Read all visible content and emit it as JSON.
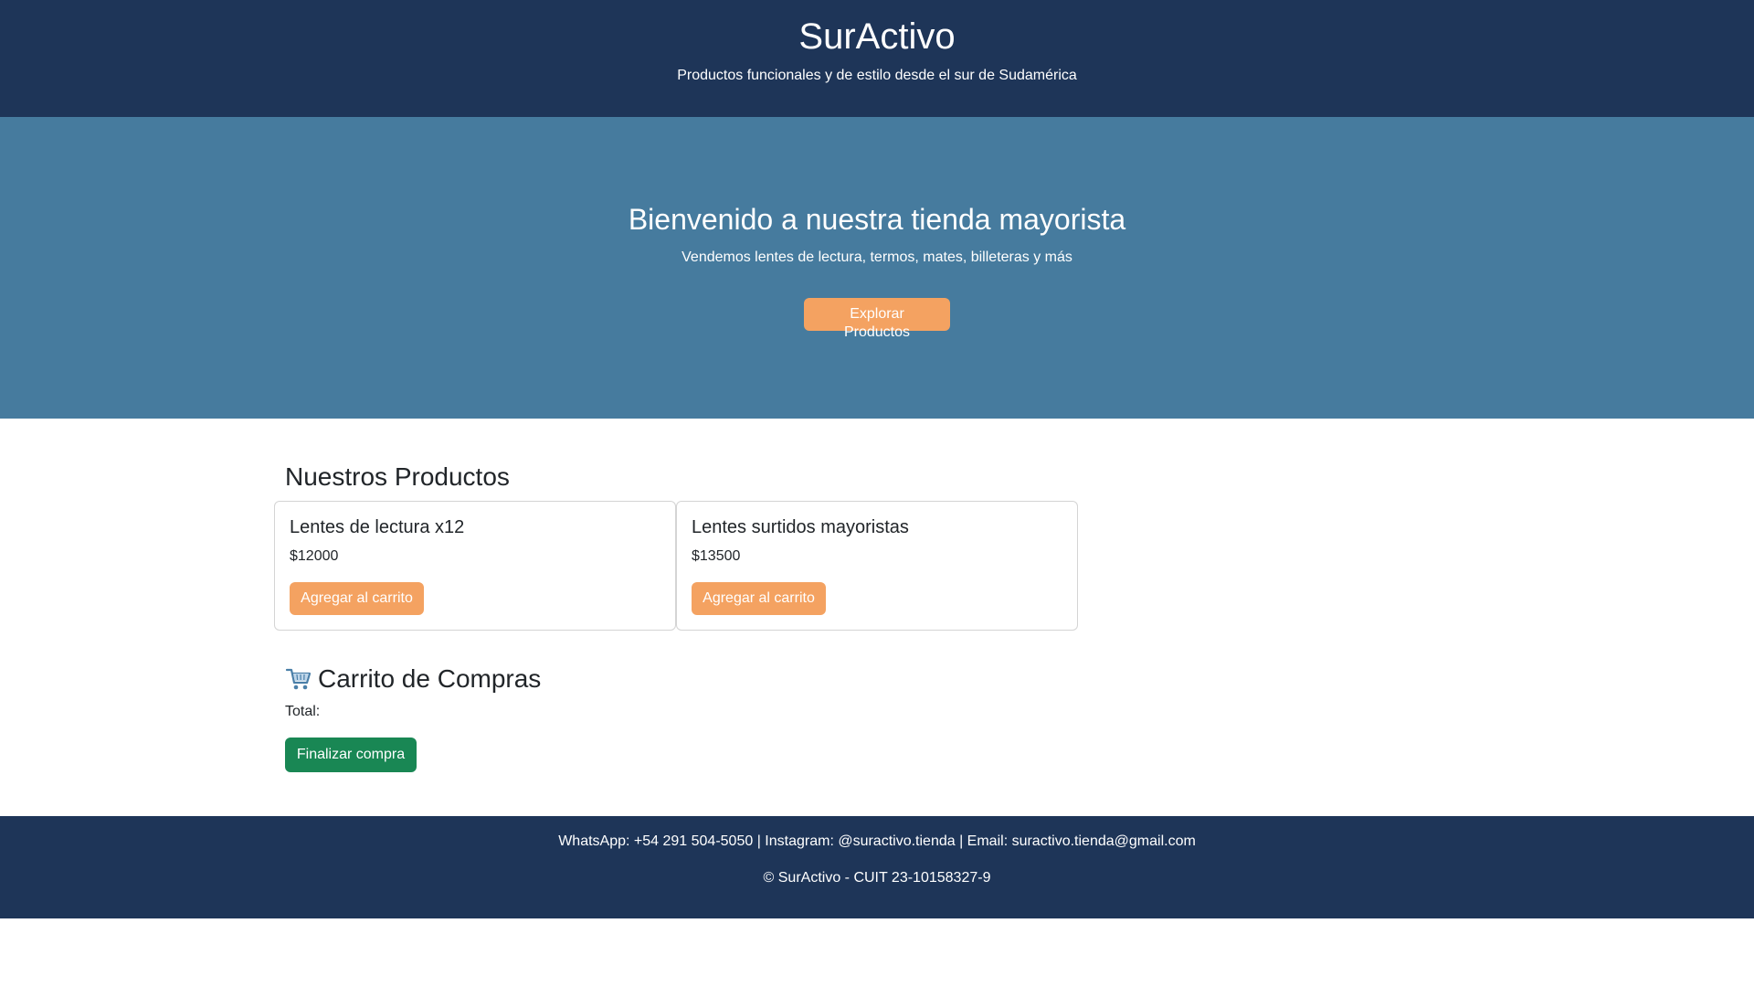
{
  "header": {
    "brand": "SurActivo",
    "tagline": "Productos funcionales y de estilo desde el sur de Sudamérica"
  },
  "hero": {
    "title": "Bienvenido a nuestra tienda mayorista",
    "subtitle": "Vendemos lentes de lectura, termos, mates, billeteras y más",
    "button_label": "Explorar Productos"
  },
  "products": {
    "title": "Nuestros Productos",
    "items": [
      {
        "name": "Lentes de lectura x12",
        "price": "$12000",
        "button_label": "Agregar al carrito"
      },
      {
        "name": "Lentes surtidos mayoristas",
        "price": "$13500",
        "button_label": "Agregar al carrito"
      }
    ]
  },
  "cart": {
    "icon": "shopping-cart-icon",
    "title": "Carrito de Compras",
    "total_label": "Total:",
    "checkout_label": "Finalizar compra"
  },
  "footer": {
    "contacts": "WhatsApp: +54 291 504-5050 | Instagram: @suractivo.tienda | Email: suractivo.tienda@gmail.com",
    "copyright": "© SurActivo - CUIT 23-10158327-9"
  },
  "colors": {
    "header_bg": "#1e3558",
    "hero_bg": "#467b9e",
    "accent_orange": "#f4a261",
    "checkout_green": "#198754"
  }
}
